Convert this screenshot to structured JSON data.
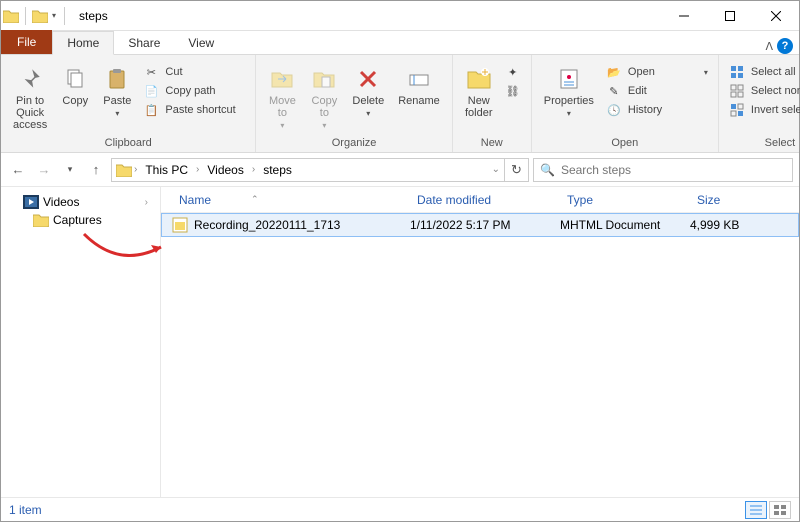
{
  "titlebar": {
    "title": "steps"
  },
  "tabs": {
    "file": "File",
    "home": "Home",
    "share": "Share",
    "view": "View"
  },
  "ribbon": {
    "clipboard": {
      "label": "Clipboard",
      "pin": "Pin to Quick\naccess",
      "copy": "Copy",
      "paste": "Paste",
      "cut": "Cut",
      "copy_path": "Copy path",
      "paste_shortcut": "Paste shortcut"
    },
    "organize": {
      "label": "Organize",
      "move": "Move\nto",
      "copy": "Copy\nto",
      "delete": "Delete",
      "rename": "Rename"
    },
    "new": {
      "label": "New",
      "folder": "New\nfolder"
    },
    "open": {
      "label": "Open",
      "properties": "Properties",
      "open": "Open",
      "edit": "Edit",
      "history": "History"
    },
    "select": {
      "label": "Select",
      "all": "Select all",
      "none": "Select none",
      "invert": "Invert selection"
    }
  },
  "breadcrumbs": [
    "This PC",
    "Videos",
    "steps"
  ],
  "search": {
    "placeholder": "Search steps"
  },
  "navpane": {
    "items": [
      {
        "label": "Videos"
      }
    ],
    "child": {
      "label": "Captures"
    }
  },
  "columns": {
    "name": "Name",
    "date": "Date modified",
    "type": "Type",
    "size": "Size"
  },
  "files": [
    {
      "name": "Recording_20220111_1713",
      "date": "1/11/2022 5:17 PM",
      "type": "MHTML Document",
      "size": "4,999 KB"
    }
  ],
  "status": {
    "count": "1 item"
  }
}
